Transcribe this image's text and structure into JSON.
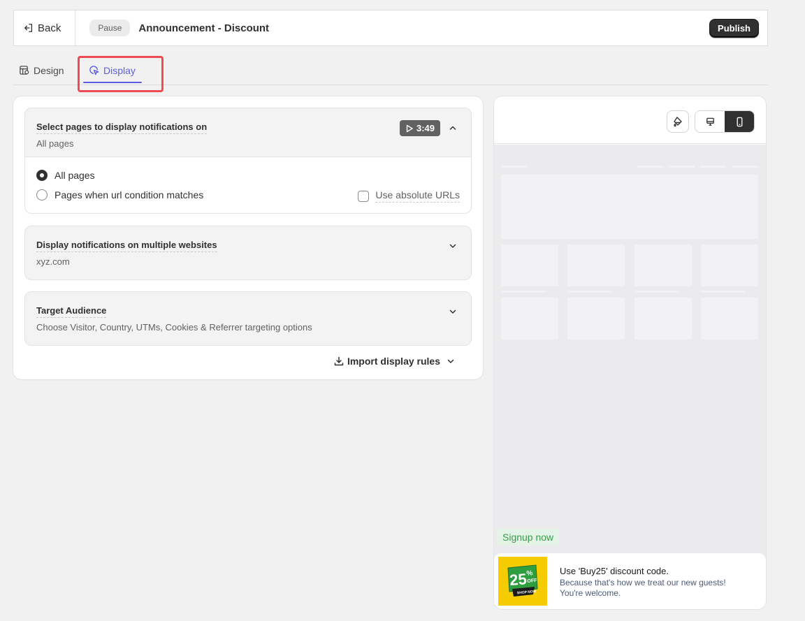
{
  "topbar": {
    "back_label": "Back",
    "status_badge": "Pause",
    "title": "Announcement - Discount",
    "publish_label": "Publish"
  },
  "tabs": [
    {
      "label": "Design",
      "icon": "layout-icon",
      "active": false
    },
    {
      "label": "Display",
      "icon": "cursor-click-icon",
      "active": true
    }
  ],
  "sections": {
    "pages": {
      "title": "Select pages to display notifications on",
      "subtitle": "All pages",
      "video_duration": "3:49",
      "expanded": true,
      "options": [
        {
          "label": "All pages",
          "selected": true
        },
        {
          "label": "Pages when url condition matches",
          "selected": false
        }
      ],
      "absolute_urls_label": "Use absolute URLs",
      "absolute_urls_checked": false
    },
    "websites": {
      "title": "Display notifications on multiple websites",
      "subtitle": "xyz.com"
    },
    "audience": {
      "title": "Target Audience",
      "subtitle": "Choose Visitor, Country, UTMs, Cookies & Referrer targeting options"
    }
  },
  "import_label": "Import display rules",
  "preview": {
    "active_device": "mobile",
    "signup_label": "Signup now",
    "notification": {
      "image_text": {
        "number": "25",
        "percent": "%",
        "off": "OFF",
        "shop": "SHOP NOW"
      },
      "title": "Use 'Buy25' discount code.",
      "body": "Because that's how we treat our new guests! You're welcome."
    }
  },
  "colors": {
    "accent": "#5c5ce0",
    "highlight": "#ef4b55",
    "primary_button": "#303030",
    "signup_text": "#3a9a4a",
    "promo_yellow": "#f5cc00",
    "promo_green": "#2e9e3e"
  }
}
